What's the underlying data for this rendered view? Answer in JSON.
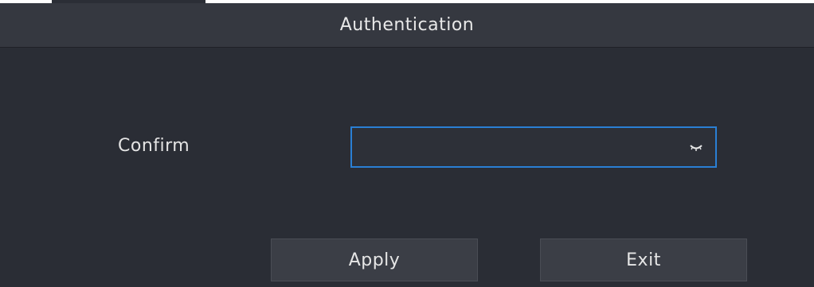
{
  "dialog": {
    "title": "Authentication",
    "field": {
      "label": "Confirm",
      "value": "",
      "icon": "eye-closed-icon"
    },
    "buttons": {
      "apply_label": "Apply",
      "exit_label": "Exit"
    }
  },
  "colors": {
    "dialog_background": "#2a2d35",
    "header_background": "#353840",
    "input_focus_border": "#2a7fd4",
    "button_background": "#3b3e46",
    "text": "#e6e6e6"
  }
}
